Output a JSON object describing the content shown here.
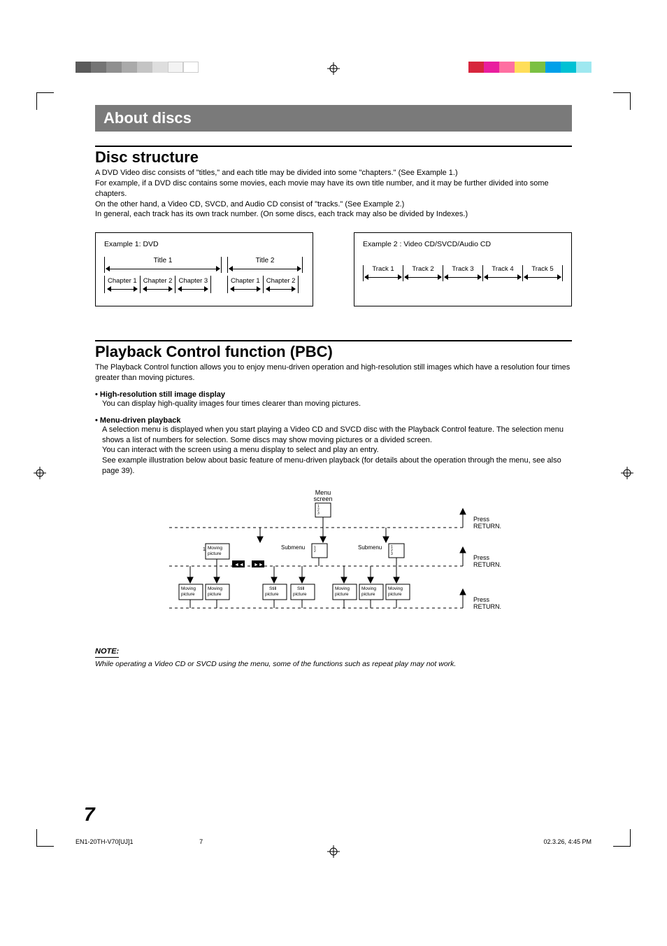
{
  "banner": "About discs",
  "section1": {
    "title": "Disc structure",
    "p1": "A DVD Video disc consists of \"titles,\" and each title may be divided into some \"chapters.\" (See Example 1.)",
    "p2": "For example, if a DVD disc contains some movies, each movie may have its own title number, and it may be further divided into some chapters.",
    "p3": "On the other hand, a Video CD, SVCD, and Audio CD consist of \"tracks.\" (See Example 2.)",
    "p4": "In general, each track has its own track number. (On some discs, each track may also be divided by Indexes.)"
  },
  "diagram1": {
    "title": "Example 1: DVD",
    "title1": "Title 1",
    "title2": "Title 2",
    "chapters1": [
      "Chapter 1",
      "Chapter 2",
      "Chapter 3"
    ],
    "chapters2": [
      "Chapter 1",
      "Chapter 2"
    ]
  },
  "diagram2": {
    "title": "Example 2 : Video CD/SVCD/Audio CD",
    "tracks": [
      "Track 1",
      "Track 2",
      "Track 3",
      "Track 4",
      "Track 5"
    ]
  },
  "section2": {
    "title": "Playback Control function (PBC)",
    "intro": "The Playback Control function allows you to enjoy menu-driven operation and high-resolution still images which have a resolution four times greater than moving pictures.",
    "b1_title": "• High-resolution still image display",
    "b1_text": "You can display high-quality images four times clearer than moving pictures.",
    "b2_title": "• Menu-driven playback",
    "b2_text1": "A selection menu is displayed when you start playing a Video CD and SVCD disc with the Playback Control feature. The selection menu shows a list of numbers for selection. Some discs may show moving pictures or a divided screen.",
    "b2_text2": "You can interact with the screen using a menu display to select and play an entry.",
    "b2_text3": "See example illustration below about basic feature of menu-driven playback (for details about the operation through the menu, see also page 39)."
  },
  "pbc": {
    "menu_screen": "Menu\nscreen",
    "submenu": "Submenu",
    "moving_picture": "Moving\npicture",
    "still_picture": "Still\npicture",
    "press_return": "Press\nRETURN.",
    "prev_icon": "◄◄",
    "next_icon": "►►",
    "num1": "1",
    "menu_items": "1\n2\n3",
    "sub_items": "1\n2"
  },
  "note": {
    "title": "NOTE:",
    "text": "While operating a Video CD or SVCD using the menu, some of the functions such as repeat play may not work."
  },
  "page_number": "7",
  "footer": {
    "left": "EN1-20TH-V70[UJ]1",
    "mid": "7",
    "right": "02.3.26, 4:45 PM"
  },
  "colors": {
    "strip_left": [
      "#5a5a5a",
      "#757575",
      "#8f8f8f",
      "#aaaaaa",
      "#c4c4c4",
      "#dedede",
      "#f3f3f3",
      "#ffffff"
    ],
    "strip_right": [
      "#d7263d",
      "#e91e9e",
      "#ff6fa1",
      "#ffde59",
      "#7bc043",
      "#00a0e9",
      "#00c1d4",
      "#9fe8f0"
    ]
  }
}
